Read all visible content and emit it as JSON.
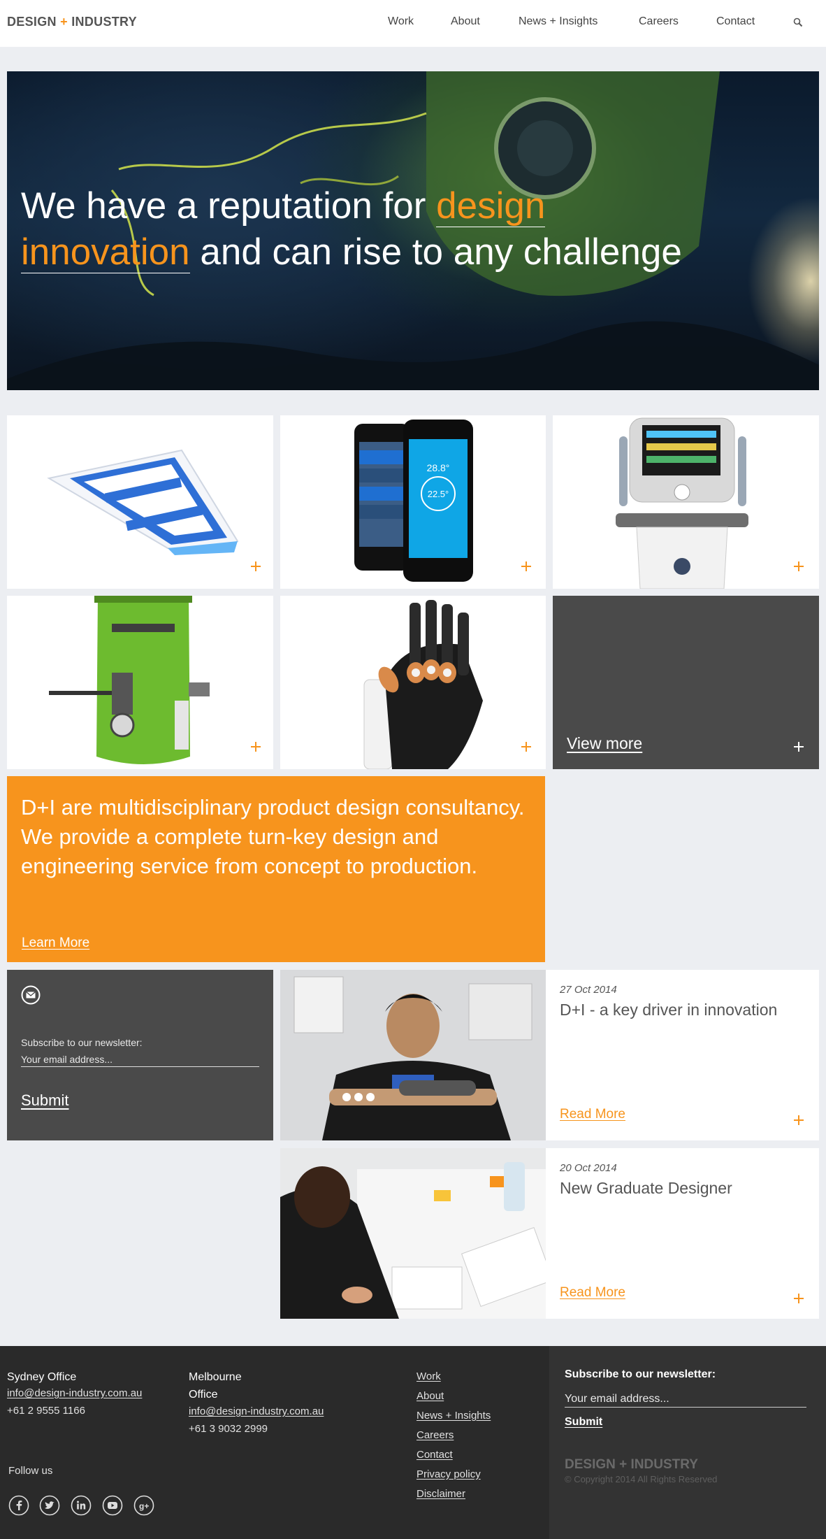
{
  "header": {
    "logo": {
      "left": "DESIGN",
      "plus": "+",
      "right": "INDUSTRY"
    },
    "nav": [
      "Work",
      "About",
      "News + Insights",
      "Careers",
      "Contact"
    ],
    "search_icon": "search-icon"
  },
  "hero": {
    "line1_pre": "We have a reputation for ",
    "line1_hl": "design",
    "line2_hl": "innovation",
    "line2_post": " and can rise to any challenge"
  },
  "tiles": {
    "view_more": "View more"
  },
  "about": {
    "text": "D+I are multidisciplinary product design consultancy. We provide a complete turn-key design and engineering service from concept to production.",
    "link": "Learn More"
  },
  "newsletter": {
    "label": "Subscribe to our newsletter:",
    "placeholder": "Your email address...",
    "submit": "Submit"
  },
  "news": [
    {
      "date": "27 Oct 2014",
      "title": "D+I - a key driver in innovation",
      "link": "Read More"
    },
    {
      "date": "20 Oct 2014",
      "title": "New Graduate Designer",
      "link": "Read More"
    }
  ],
  "footer": {
    "sydney": {
      "title": "Sydney Office",
      "email": "info@design-industry.com.au",
      "phone": "+61 2 9555 1166"
    },
    "melbourne": {
      "title_1": "Melbourne",
      "title_2": "Office",
      "email": "info@design-industry.com.au",
      "phone": "+61 3 9032 2999"
    },
    "follow": "Follow us",
    "social": [
      "facebook-icon",
      "twitter-icon",
      "linkedin-icon",
      "youtube-icon",
      "google-plus-icon"
    ],
    "links": [
      "Work",
      "About",
      "News + Insights",
      "Careers",
      "Contact",
      "Privacy policy",
      "Disclaimer"
    ],
    "newsletter": {
      "label": "Subscribe to our newsletter:",
      "placeholder": "Your email address...",
      "submit": "Submit"
    },
    "logo": "DESIGN + INDUSTRY",
    "copyright": "© Copyright 2014 All Rights Reserved"
  },
  "colors": {
    "accent": "#f7941d",
    "dark_tile": "#4a4a4a",
    "footer": "#2a2a2a",
    "background": "#eceef2"
  }
}
